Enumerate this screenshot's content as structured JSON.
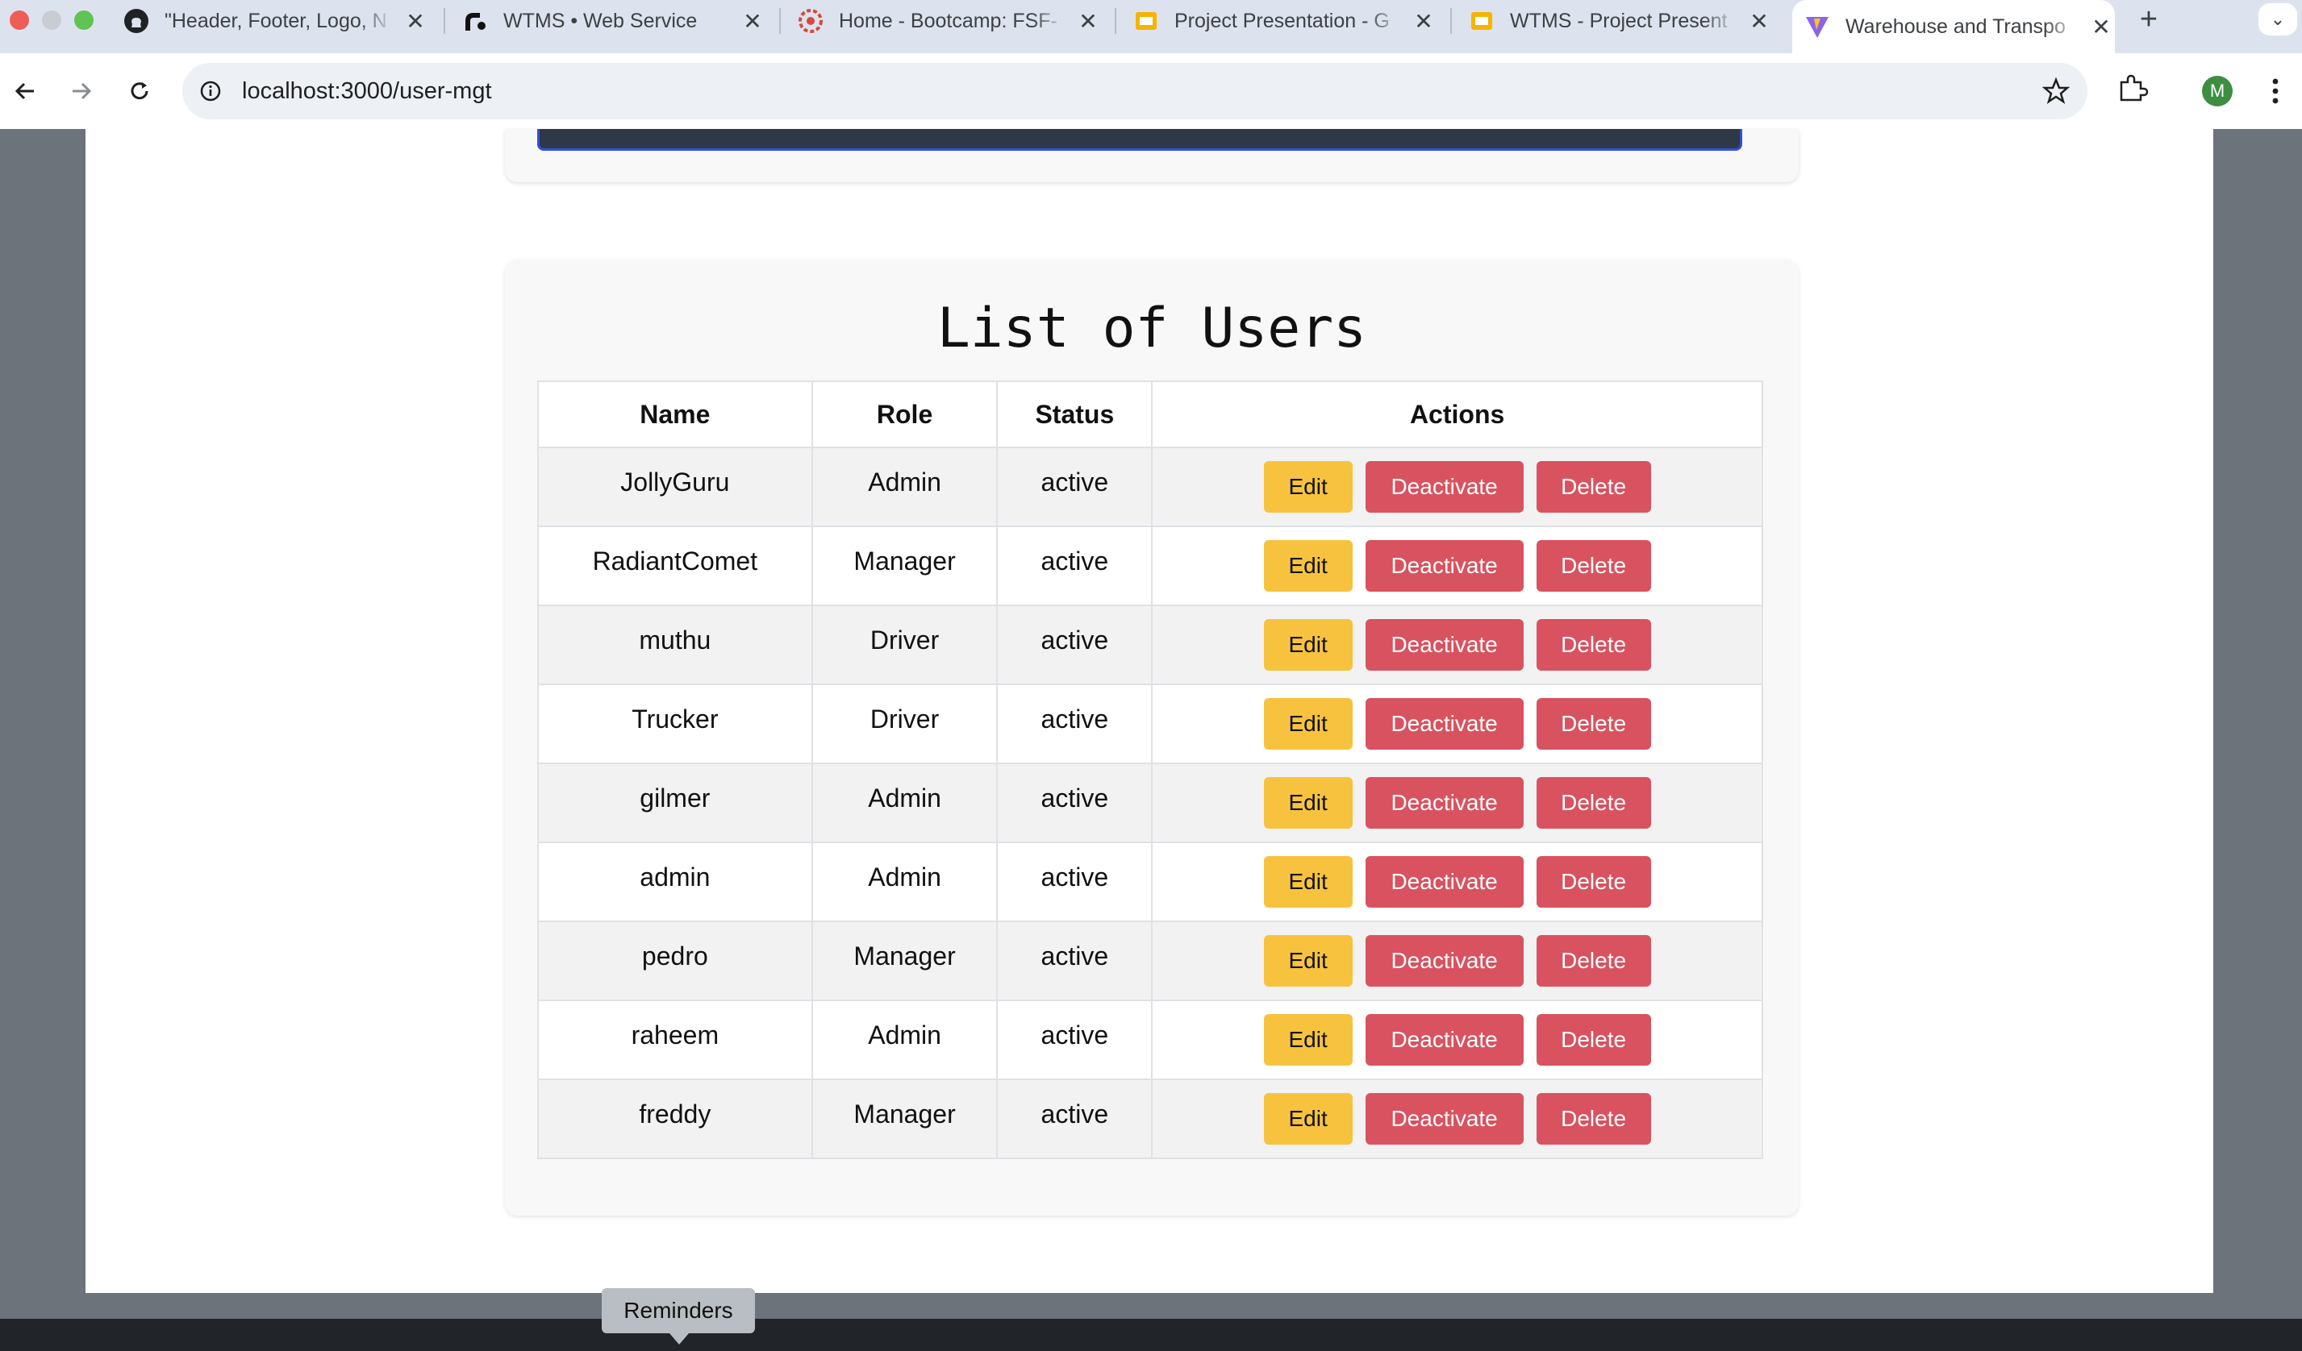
{
  "browser": {
    "tabs": [
      {
        "title": "\"Header, Footer, Logo, N",
        "icon": "github-icon",
        "active": false
      },
      {
        "title": "WTMS • Web Service",
        "icon": "render-icon",
        "active": false
      },
      {
        "title": "Home - Bootcamp: FSF-",
        "icon": "bootcamp-icon",
        "active": false
      },
      {
        "title": "Project Presentation - G",
        "icon": "slides-icon",
        "active": false
      },
      {
        "title": "WTMS - Project Present",
        "icon": "slides-icon",
        "active": false
      },
      {
        "title": "Warehouse and Transpo",
        "icon": "vite-icon",
        "active": true
      }
    ],
    "url": "localhost:3000/user-mgt",
    "profile_initial": "M"
  },
  "users_section": {
    "title": "List of Users",
    "columns": [
      "Name",
      "Role",
      "Status",
      "Actions"
    ],
    "action_labels": {
      "edit": "Edit",
      "deactivate": "Deactivate",
      "delete": "Delete"
    },
    "rows": [
      {
        "name": "JollyGuru",
        "role": "Admin",
        "status": "active"
      },
      {
        "name": "RadiantComet",
        "role": "Manager",
        "status": "active"
      },
      {
        "name": "muthu",
        "role": "Driver",
        "status": "active"
      },
      {
        "name": "Trucker",
        "role": "Driver",
        "status": "active"
      },
      {
        "name": "gilmer",
        "role": "Admin",
        "status": "active"
      },
      {
        "name": "admin",
        "role": "Admin",
        "status": "active"
      },
      {
        "name": "pedro",
        "role": "Manager",
        "status": "active"
      },
      {
        "name": "raheem",
        "role": "Admin",
        "status": "active"
      },
      {
        "name": "freddy",
        "role": "Manager",
        "status": "active"
      }
    ]
  },
  "tooltip": {
    "text": "Reminders"
  },
  "colors": {
    "edit_button": "#f7c33f",
    "danger_button": "#d9525f",
    "page_backdrop": "#6c737b"
  }
}
